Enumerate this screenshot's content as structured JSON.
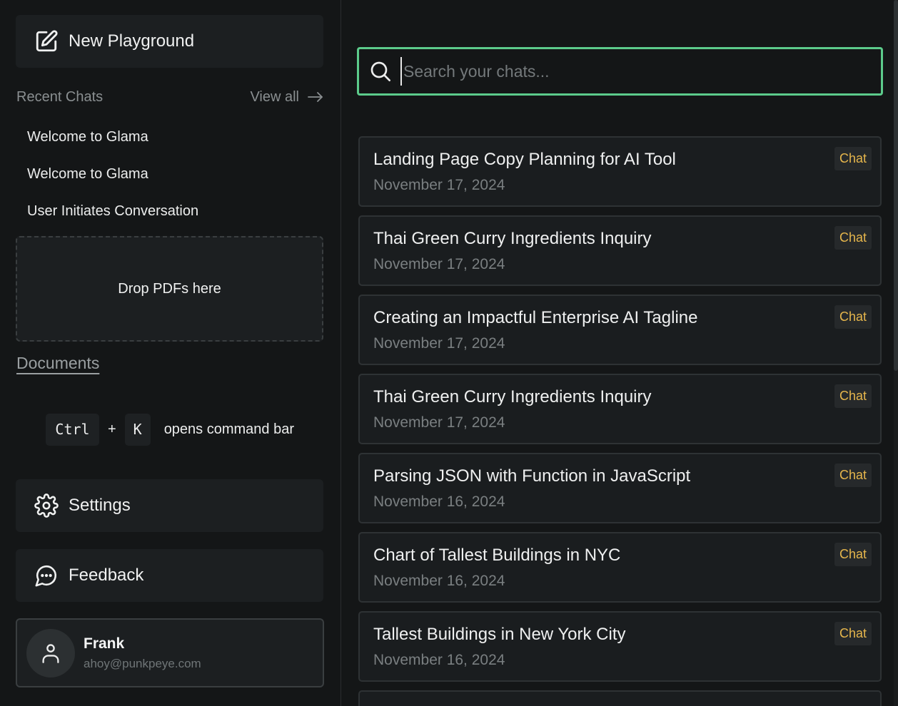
{
  "sidebar": {
    "new_playground_label": "New Playground",
    "recent_chats_label": "Recent Chats",
    "view_all_label": "View all",
    "recent_items": [
      {
        "label": "Welcome to Glama"
      },
      {
        "label": "Welcome to Glama"
      },
      {
        "label": "User Initiates Conversation"
      }
    ],
    "dropzone_label": "Drop PDFs here",
    "documents_label": "Documents",
    "shortcut": {
      "key1": "Ctrl",
      "plus": "+",
      "key2": "K",
      "description": "opens command bar"
    },
    "settings_label": "Settings",
    "feedback_label": "Feedback",
    "user": {
      "name": "Frank",
      "email": "ahoy@punkpeye.com"
    }
  },
  "main": {
    "search": {
      "placeholder": "Search your chats...",
      "value": ""
    },
    "chats": [
      {
        "title": "Landing Page Copy Planning for AI Tool",
        "date": "November 17, 2024",
        "badge": "Chat"
      },
      {
        "title": "Thai Green Curry Ingredients Inquiry",
        "date": "November 17, 2024",
        "badge": "Chat"
      },
      {
        "title": "Creating an Impactful Enterprise AI Tagline",
        "date": "November 17, 2024",
        "badge": "Chat"
      },
      {
        "title": "Thai Green Curry Ingredients Inquiry",
        "date": "November 17, 2024",
        "badge": "Chat"
      },
      {
        "title": "Parsing JSON with Function in JavaScript",
        "date": "November 16, 2024",
        "badge": "Chat"
      },
      {
        "title": "Chart of Tallest Buildings in NYC",
        "date": "November 16, 2024",
        "badge": "Chat"
      },
      {
        "title": "Tallest Buildings in New York City",
        "date": "November 16, 2024",
        "badge": "Chat"
      }
    ]
  },
  "colors": {
    "accent_green": "#5ccb8b",
    "badge_gold": "#e6b64c",
    "background": "#141617",
    "card": "#1c1f21"
  },
  "icons": {
    "new_playground": "edit-square-icon",
    "view_all": "arrow-right-icon",
    "settings": "gear-icon",
    "feedback": "chat-bubble-icon",
    "user": "user-icon",
    "search": "search-icon"
  }
}
